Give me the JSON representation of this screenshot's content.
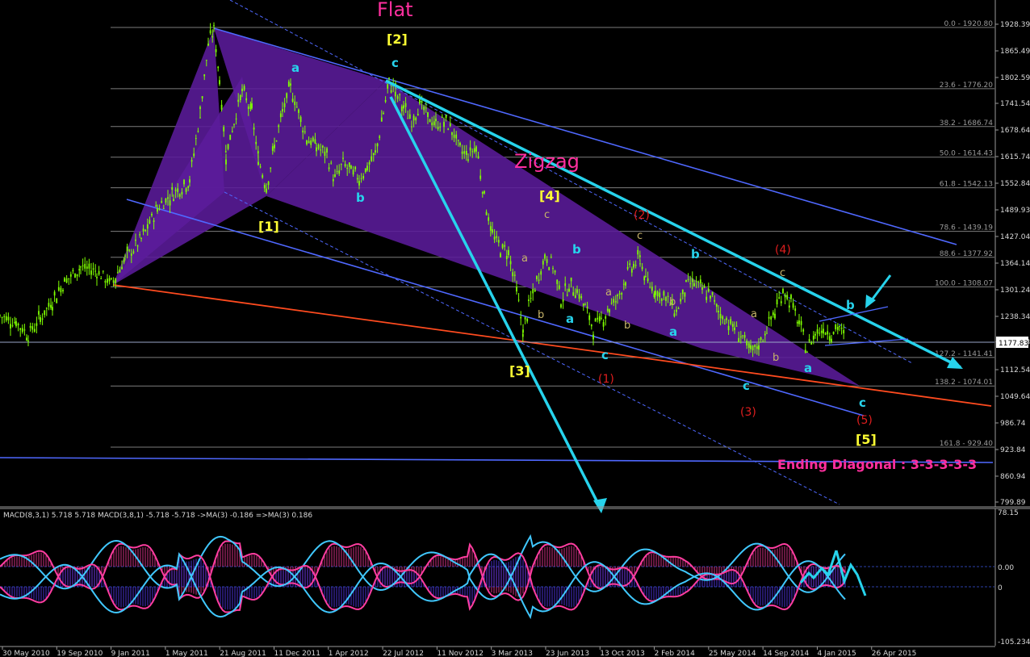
{
  "chart_data": {
    "type": "line",
    "price_axis": {
      "range": [
        799.89,
        1928.39
      ],
      "ticks": [
        "1928.39",
        "1865.49",
        "1802.59",
        "1741.54",
        "1678.64",
        "1615.74",
        "1552.84",
        "1489.93",
        "1427.04",
        "1364.14",
        "1301.24",
        "1238.34",
        "1177.83",
        "1112.54",
        "1049.64",
        "986.74",
        "923.84",
        "860.94",
        "799.89"
      ],
      "current_price": "1177.83"
    },
    "fibonacci_levels": [
      {
        "label": "0.0 - 1920.80",
        "price": 1920.8
      },
      {
        "label": "23.6 - 1776.20",
        "price": 1776.2
      },
      {
        "label": "38.2 - 1686.74",
        "price": 1686.74
      },
      {
        "label": "50.0 - 1614.43",
        "price": 1614.43
      },
      {
        "label": "61.8 - 1542.13",
        "price": 1542.13
      },
      {
        "label": "78.6 - 1439.19",
        "price": 1439.19
      },
      {
        "label": "88.6 - 1377.92",
        "price": 1377.92
      },
      {
        "label": "100.0 - 1308.07",
        "price": 1308.07
      },
      {
        "label": "127.2 - 1141.41",
        "price": 1141.41
      },
      {
        "label": "138.2 - 1074.01",
        "price": 1074.01
      },
      {
        "label": "161.8 - 929.40",
        "price": 929.4
      }
    ],
    "x_axis_dates": [
      "30 May 2010",
      "19 Sep 2010",
      "9 Jan 2011",
      "1 May 2011",
      "21 Aug 2011",
      "11 Dec 2011",
      "1 Apr 2012",
      "22 Jul 2012",
      "11 Nov 2012",
      "3 Mar 2013",
      "23 Jun 2013",
      "13 Oct 2013",
      "2 Feb 2014",
      "25 May 2014",
      "14 Sep 2014",
      "4 Jan 2015",
      "26 Apr 2015"
    ],
    "price_series": [
      [
        0,
        1240
      ],
      [
        20,
        1225
      ],
      [
        35,
        1195
      ],
      [
        50,
        1235
      ],
      [
        65,
        1275
      ],
      [
        80,
        1320
      ],
      [
        100,
        1355
      ],
      [
        120,
        1345
      ],
      [
        138,
        1315
      ],
      [
        155,
        1375
      ],
      [
        175,
        1420
      ],
      [
        195,
        1495
      ],
      [
        215,
        1530
      ],
      [
        235,
        1560
      ],
      [
        248,
        1720
      ],
      [
        258,
        1880
      ],
      [
        265,
        1915
      ],
      [
        272,
        1800
      ],
      [
        280,
        1620
      ],
      [
        290,
        1700
      ],
      [
        300,
        1770
      ],
      [
        312,
        1720
      ],
      [
        320,
        1610
      ],
      [
        330,
        1545
      ],
      [
        340,
        1640
      ],
      [
        350,
        1720
      ],
      [
        360,
        1780
      ],
      [
        370,
        1720
      ],
      [
        380,
        1660
      ],
      [
        392,
        1640
      ],
      [
        405,
        1620
      ],
      [
        415,
        1560
      ],
      [
        425,
        1600
      ],
      [
        435,
        1580
      ],
      [
        445,
        1565
      ],
      [
        455,
        1590
      ],
      [
        465,
        1620
      ],
      [
        475,
        1720
      ],
      [
        482,
        1790
      ],
      [
        490,
        1770
      ],
      [
        500,
        1730
      ],
      [
        510,
        1700
      ],
      [
        520,
        1740
      ],
      [
        530,
        1710
      ],
      [
        540,
        1690
      ],
      [
        550,
        1700
      ],
      [
        560,
        1680
      ],
      [
        570,
        1630
      ],
      [
        580,
        1620
      ],
      [
        590,
        1640
      ],
      [
        600,
        1520
      ],
      [
        610,
        1430
      ],
      [
        620,
        1400
      ],
      [
        630,
        1390
      ],
      [
        640,
        1300
      ],
      [
        648,
        1200
      ],
      [
        655,
        1260
      ],
      [
        665,
        1320
      ],
      [
        675,
        1380
      ],
      [
        685,
        1360
      ],
      [
        695,
        1280
      ],
      [
        705,
        1310
      ],
      [
        715,
        1300
      ],
      [
        725,
        1260
      ],
      [
        735,
        1210
      ],
      [
        745,
        1230
      ],
      [
        755,
        1260
      ],
      [
        765,
        1280
      ],
      [
        775,
        1330
      ],
      [
        785,
        1360
      ],
      [
        793,
        1375
      ],
      [
        800,
        1320
      ],
      [
        812,
        1300
      ],
      [
        825,
        1280
      ],
      [
        838,
        1250
      ],
      [
        850,
        1310
      ],
      [
        860,
        1320
      ],
      [
        870,
        1300
      ],
      [
        880,
        1290
      ],
      [
        890,
        1250
      ],
      [
        900,
        1230
      ],
      [
        910,
        1210
      ],
      [
        920,
        1190
      ],
      [
        930,
        1150
      ],
      [
        940,
        1170
      ],
      [
        950,
        1210
      ],
      [
        960,
        1250
      ],
      [
        970,
        1300
      ],
      [
        980,
        1270
      ],
      [
        990,
        1220
      ],
      [
        1000,
        1160
      ],
      [
        1010,
        1200
      ],
      [
        1020,
        1210
      ],
      [
        1030,
        1200
      ],
      [
        1040,
        1215
      ],
      [
        1047,
        1180
      ]
    ],
    "wave_labels": [
      {
        "text": "Flat",
        "kind": "title"
      },
      {
        "text": "Zigzag",
        "kind": "title"
      },
      {
        "text": "[1]",
        "kind": "major"
      },
      {
        "text": "[2]",
        "kind": "major"
      },
      {
        "text": "[3]",
        "kind": "major"
      },
      {
        "text": "[4]",
        "kind": "major"
      },
      {
        "text": "[5]",
        "kind": "major"
      },
      {
        "text": "a",
        "kind": "minor"
      },
      {
        "text": "b",
        "kind": "minor"
      },
      {
        "text": "c",
        "kind": "minor"
      },
      {
        "text": "(1)",
        "kind": "sub"
      },
      {
        "text": "(2)",
        "kind": "sub"
      },
      {
        "text": "(3)",
        "kind": "sub"
      },
      {
        "text": "(4)",
        "kind": "sub"
      },
      {
        "text": "(5)",
        "kind": "sub"
      },
      {
        "text": "Ending Diagonal : 3-3-3-3-3",
        "kind": "note"
      }
    ],
    "macd": {
      "header": "MACD(8,3,1) 5.718 5.718  MACD(3,8,1) -5.718 -5.718  ->MA(3) -0.186  =>MA(3) 0.186",
      "ticks": [
        "78.15",
        "0.00",
        "0",
        "-105.234"
      ]
    }
  },
  "colors": {
    "background": "#000000",
    "candles": "#7fff00",
    "wedge_fill": "#5a1a9a",
    "channel": "#4f68ff",
    "cyan": "#27d3ec",
    "orange": "#ff4b1f",
    "fib_line": "#8a8a8a",
    "title_pink": "#ff2f9e",
    "wave_major": "#ffff33",
    "wave_sub": "#e01e1e",
    "macd_pink": "#ff3da0",
    "macd_cyan": "#40c8ff",
    "macd_hist": "#a020f0"
  }
}
